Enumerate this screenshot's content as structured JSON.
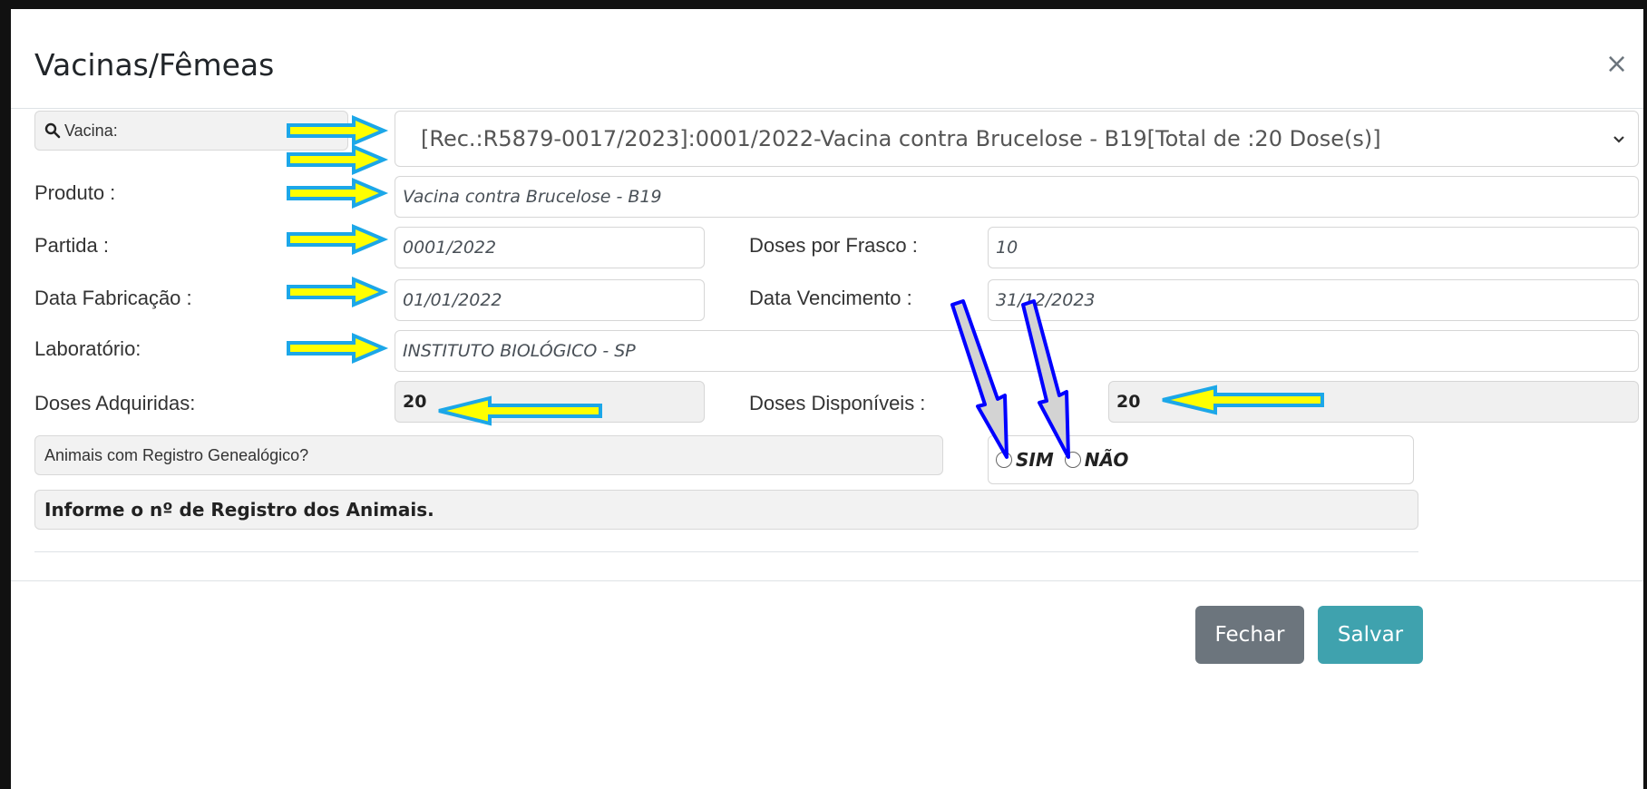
{
  "modal": {
    "title": "Vacinas/Fêmeas",
    "close_glyph": "×"
  },
  "form": {
    "vacina_label": "Vacina:",
    "vacina_selected": "[Rec.:R5879-0017/2023]:0001/2022-Vacina contra Brucelose - B19[Total de :20 Dose(s)]",
    "produto_label": "Produto :",
    "produto_value": "Vacina contra Brucelose - B19",
    "partida_label": "Partida :",
    "partida_value": "0001/2022",
    "doses_frasco_label": "Doses por Frasco :",
    "doses_frasco_value": "10",
    "data_fab_label": "Data Fabricação :",
    "data_fab_value": "01/01/2022",
    "data_venc_label": "Data Vencimento :",
    "data_venc_value": "31/12/2023",
    "laboratorio_label": "Laboratório:",
    "laboratorio_value": "INSTITUTO BIOLÓGICO - SP",
    "doses_adq_label": "Doses Adquiridas:",
    "doses_adq_value": "20",
    "doses_disp_label": "Doses Disponíveis :",
    "doses_disp_value": "20",
    "registro_question": "Animais com Registro Genealógico?",
    "radio_sim": "SIM",
    "radio_nao": "NÃO",
    "info_text": "Informe o nº de Registro dos Animais."
  },
  "footer": {
    "close_label": "Fechar",
    "save_label": "Salvar"
  },
  "icons": {
    "search": "search-icon",
    "caret": "chevron-down-icon",
    "close": "close-icon"
  },
  "colors": {
    "save_button": "#3fa2ae",
    "close_button": "#6c757d",
    "annotation_arrow_fill": "#ffff00",
    "annotation_arrow_stroke": "#1ca7e8",
    "annotation_down_arrow_fill": "#d3d3d3",
    "annotation_down_arrow_stroke": "#0000ff"
  }
}
